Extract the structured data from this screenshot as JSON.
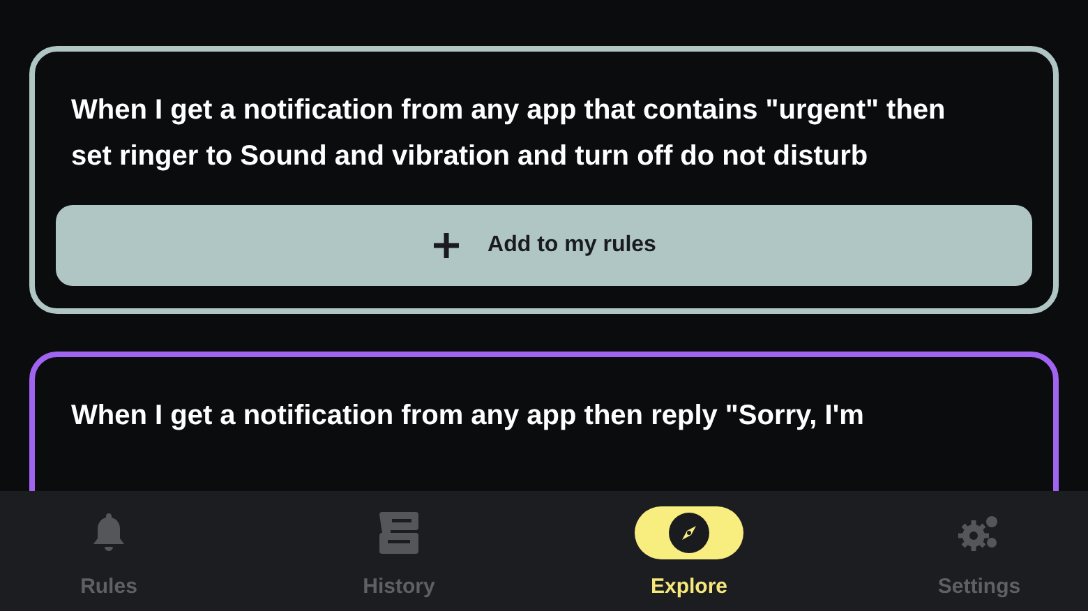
{
  "cards": [
    {
      "text": "When I get a notification from any app that contains \"urgent\" then set ringer to Sound and vibration and turn off do not disturb",
      "color": "#b0c6c4",
      "button": "Add to my rules"
    },
    {
      "text": "When I get a notification from any app then reply \"Sorry, I'm",
      "color": "#a064f0"
    }
  ],
  "nav": [
    {
      "label": "Rules",
      "selected": false
    },
    {
      "label": "History",
      "selected": false
    },
    {
      "label": "Explore",
      "selected": true
    },
    {
      "label": "Settings",
      "selected": false
    }
  ]
}
